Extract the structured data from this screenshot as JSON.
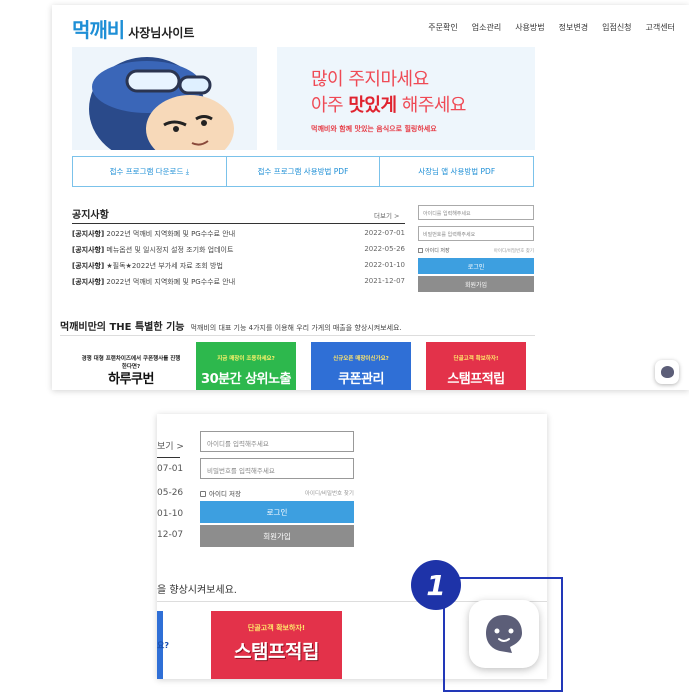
{
  "header": {
    "logo_main": "먹깨비",
    "logo_sub": "사장님사이트",
    "nav": [
      "주문확인",
      "업소관리",
      "사용방법",
      "정보변경",
      "입점신청",
      "고객센터"
    ]
  },
  "banner": {
    "line1": "많이 주지마세요",
    "line2_pre": "아주 ",
    "line2_bold": "맛있게",
    "line2_post": " 해주세요",
    "sub": "먹깨비와 함께 맛있는 음식으로 힐링하세요"
  },
  "downloads": [
    "접수 프로그램 다운로드 ⤓",
    "접수 프로그램 사용방법 PDF",
    "사장님 앱 사용방법 PDF"
  ],
  "notice": {
    "title": "공지사항",
    "more": "더보기 >",
    "items": [
      {
        "tag": "[공지사항]",
        "text": " 2022년 먹깨비 지역화폐 및 PG수수료 안내",
        "date": "2022-07-01"
      },
      {
        "tag": "[공지사항]",
        "text": " 메뉴옵션 및 일시정지 설정 조기화 업데이트",
        "date": "2022-05-26"
      },
      {
        "tag": "[공지사항]",
        "text": " ★필독★2022년 부가세 자료 조회 방법",
        "date": "2022-01-10"
      },
      {
        "tag": "[공지사항]",
        "text": " 2022년 먹깨비 지역화폐 및 PG수수료 안내",
        "date": "2021-12-07"
      }
    ]
  },
  "login": {
    "id_placeholder": "아이디를 입력해주세요",
    "pw_placeholder": "비밀번호를 입력해주세요",
    "remember": "아이디 저장",
    "find": "아이디/비밀번호 찾기",
    "login_button": "로그인",
    "join_button": "회원가입"
  },
  "features": {
    "title": "먹깨비만의 THE 특별한 기능",
    "subtitle": "먹깨비의 대표 기능 4가지를 이용해 우리 가게의 매출을 향상시켜보세요.",
    "cards": [
      {
        "top": "경쟁 대형 프랜차이즈에서 쿠폰행사를 진행한다면?",
        "big": "하루쿠번",
        "bg": "#ffffff",
        "top_color": "#222222",
        "big_color": "#111111"
      },
      {
        "top": "지금 매장이 조용하세요?",
        "big": "30분간 상위노출",
        "bg": "#2db84d",
        "top_color": "#fff36b",
        "big_color": "#ffffff"
      },
      {
        "top": "신규오픈 매장이신가요?",
        "big": "쿠폰관리",
        "bg": "#2f6fd6",
        "top_color": "#ffe66b",
        "big_color": "#ffffff"
      },
      {
        "top": "단골고객 확보하자!",
        "big": "스탬프적립",
        "bg": "#e3324a",
        "top_color": "#ffe66b",
        "big_color": "#ffffff"
      }
    ]
  },
  "zoom": {
    "more": "보기 >",
    "dates": [
      "07-01",
      "05-26",
      "01-10",
      "12-07"
    ],
    "feature_text": "을 향상시켜보세요.",
    "left_card_text": "요?",
    "card_top": "단골고객 확보하자!",
    "card_big": "스탬프적립"
  },
  "callout": {
    "number": "1",
    "chat_icon": "chat-bot-icon",
    "highlight_color": "#2238b8"
  }
}
